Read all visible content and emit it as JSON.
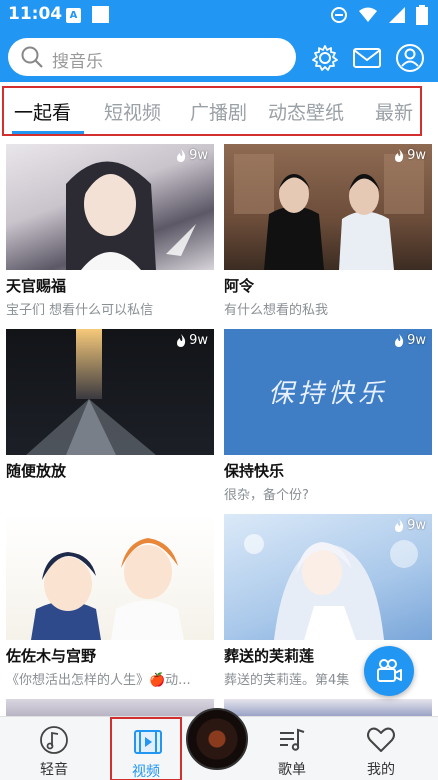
{
  "status_bar": {
    "time": "11:04",
    "app_badge": "A"
  },
  "search": {
    "placeholder": "搜音乐"
  },
  "tabs": [
    {
      "label": "一起看",
      "active": true
    },
    {
      "label": "短视频",
      "active": false
    },
    {
      "label": "广播剧",
      "active": false
    },
    {
      "label": "动态壁纸",
      "active": false
    },
    {
      "label": "最新",
      "active": false
    }
  ],
  "videos": [
    {
      "title": "天官赐福",
      "subtitle": "宝子们 想看什么可以私信",
      "heat": "9w"
    },
    {
      "title": "阿令",
      "subtitle": "有什么想看的私我",
      "heat": "9w"
    },
    {
      "title": "随便放放",
      "subtitle": "",
      "heat": "9w"
    },
    {
      "title": "保持快乐",
      "subtitle": "很杂，备个份?",
      "heat": "9w",
      "thumb_text": "保持快乐"
    },
    {
      "title": "佐佐木与宫野",
      "subtitle": "《你想活出怎样的人生》🍎动...",
      "heat": ""
    },
    {
      "title": "葬送的芙莉莲",
      "subtitle": "葬送的芙莉莲。第4集",
      "heat": "9w"
    }
  ],
  "bottom_nav": [
    {
      "label": "轻音",
      "icon": "music-note-icon"
    },
    {
      "label": "视频",
      "icon": "video-icon",
      "active": true
    },
    {
      "label": "歌单",
      "icon": "playlist-icon"
    },
    {
      "label": "我的",
      "icon": "heart-icon"
    }
  ],
  "colors": {
    "primary": "#2196f3",
    "highlight_box": "#d32f2f"
  }
}
